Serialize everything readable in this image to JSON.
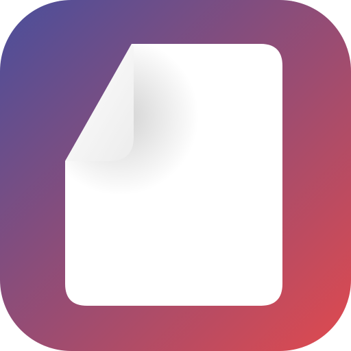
{
  "icon": {
    "semantic": "document-icon",
    "background_gradient": {
      "start_color": "#4a4f9b",
      "end_color": "#e04a4e"
    },
    "page_color": "#ffffff",
    "fold_shadow_color": "#000000"
  }
}
